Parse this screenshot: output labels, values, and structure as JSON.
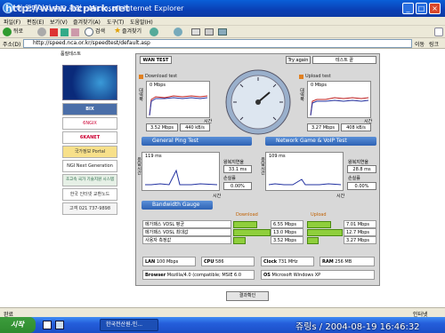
{
  "window": {
    "title": "이 웹페이지 속도 측정 - Microsoft Internet Explorer",
    "watermark": "http://www.bcpark.net"
  },
  "menu": {
    "items": [
      "파일(F)",
      "편집(E)",
      "보기(V)",
      "즐겨찾기(A)",
      "도구(T)",
      "도움말(H)"
    ]
  },
  "toolbar": {
    "back": "뒤로",
    "search": "검색",
    "favorites": "즐겨찾기"
  },
  "address": {
    "label": "주소(D)",
    "url": "http://speed.nca.or.kr/speedtest/default.asp",
    "go": "이동",
    "links": "링크"
  },
  "sidebar": {
    "title": "품질테스트",
    "items": [
      "BIX",
      "6NGIX",
      "6KANET",
      "국가정보 Portal",
      "NGI Next Generation",
      "초고속 국가 기술지원 시스템",
      "한국 인터넷 교환노드",
      "고객 021 737-9898"
    ]
  },
  "panel": {
    "tab": "WAN TEST",
    "try_again": "Try again",
    "test_end": "테스트 끝",
    "download": {
      "title": "Download test",
      "unit": "0 Mbps",
      "yaxis": "대역폭",
      "time": "시간",
      "mbps": "3.52 Mbps",
      "kbs": "440 kB/s"
    },
    "upload": {
      "title": "Upload test",
      "unit": "0 Mbps",
      "yaxis": "대역폭",
      "time": "시간",
      "mbps": "3.27 Mbps",
      "kbs": "408 kB/s"
    },
    "ping": {
      "header": "General Ping Test",
      "yaxis": "응답시간",
      "ms": "119 ms",
      "time": "시간",
      "avg_label": "왕복지연율",
      "avg": "33.1 ms",
      "loss_label": "손실률",
      "loss": "0.00%"
    },
    "voip": {
      "header": "Network Game & VoIP Test",
      "yaxis": "응답시간",
      "ms": "109 ms",
      "time": "시간",
      "avg_label": "왕복지연율",
      "avg": "28.8 ms",
      "loss_label": "손실률",
      "loss": "0.00%"
    },
    "gauge": {
      "header": "Bandwidth Gauge",
      "download_label": "Download",
      "upload_label": "Upload",
      "rows": [
        {
          "label": "메가패스 VDSL 평균",
          "down": "6.55 Mbps",
          "up": "7.01 Mbps",
          "down_frac": 0.65,
          "up_frac": 0.68
        },
        {
          "label": "메가패스 VDSL 최대값",
          "down": "13.0 Mbps",
          "up": "12.7 Mbps",
          "down_frac": 1.0,
          "up_frac": 1.0
        },
        {
          "label": "사용자 측정값",
          "down": "3.52 Mbps",
          "up": "3.27 Mbps",
          "down_frac": 0.33,
          "up_frac": 0.32
        }
      ]
    },
    "system": {
      "lan_label": "LAN",
      "lan": "100 Mbps",
      "cpu_label": "CPU",
      "cpu": "586",
      "clock_label": "Clock",
      "clock": "731 MHz",
      "ram_label": "RAM",
      "ram": "256 MB",
      "browser_label": "Browser",
      "browser": "Mozilla/4.0 (compatible; MSIE 6.0",
      "os_label": "OS",
      "os": "Microsoft Windows XP"
    },
    "result_button": "결과확인"
  },
  "status": {
    "left": "완료",
    "zone": "인터넷"
  },
  "taskbar": {
    "start": "시작",
    "task": "한국전산원-인...",
    "clock": "쥬링s / 2004-08-19 16:46:32"
  }
}
